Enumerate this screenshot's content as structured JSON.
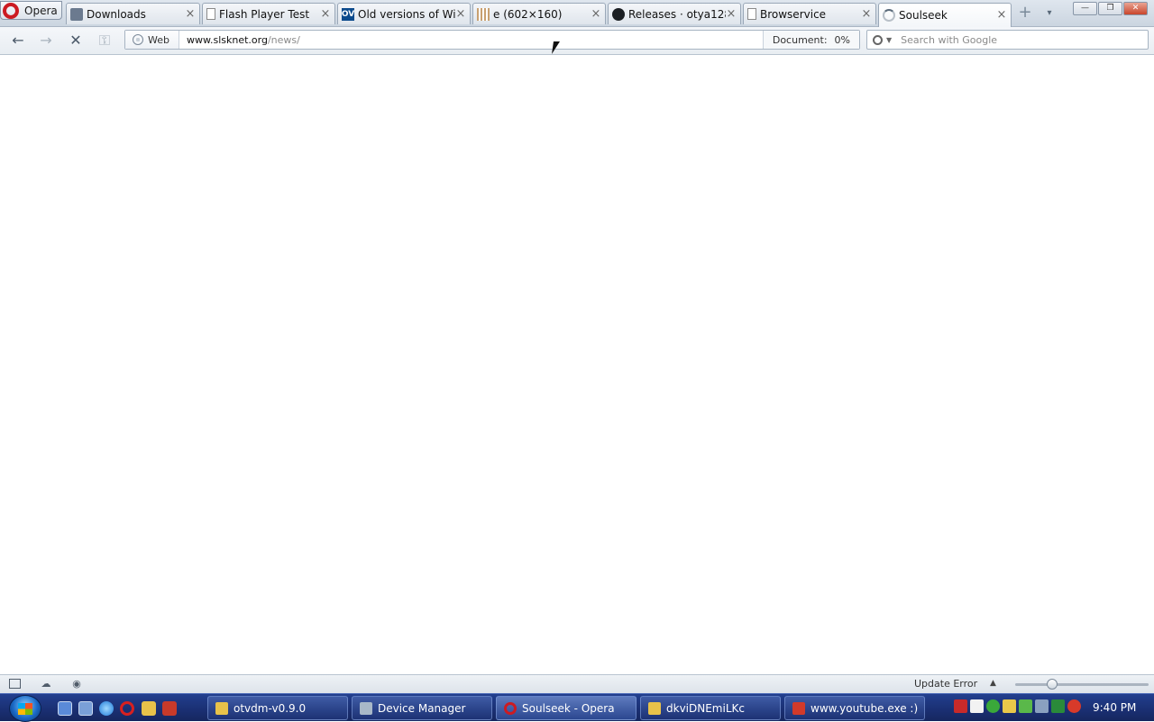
{
  "browser": {
    "menu_label": "Opera",
    "tabs": [
      {
        "label": "Downloads",
        "icon": "download-icon"
      },
      {
        "label": "Flash Player Test",
        "icon": "page-icon"
      },
      {
        "label": "Old versions of Wi...",
        "icon": "oldversion-icon",
        "icon_text": "OV"
      },
      {
        "label": "e (602×160)",
        "icon": "image-icon"
      },
      {
        "label": "Releases · otya128/...",
        "icon": "github-icon"
      },
      {
        "label": "Browservice",
        "icon": "page-icon"
      },
      {
        "label": "Soulseek",
        "icon": "loading-icon",
        "active": true
      }
    ],
    "tab_close_glyph": "×",
    "new_tab_glyph": "+",
    "tab_menu_glyph": "▾",
    "window_buttons": {
      "minimize": "—",
      "restore": "❐",
      "close": "✕"
    }
  },
  "toolbar": {
    "back_glyph": "←",
    "forward_glyph": "→",
    "stop_glyph": "✕",
    "key_glyph": "⚿",
    "web_badge": "Web",
    "url_host": "www.slsknet.org",
    "url_path": "/news/",
    "document_label": "Document:",
    "document_progress": "0%",
    "search_placeholder": "Search with Google"
  },
  "statusbar": {
    "update_error": "Update Error",
    "up_arrow": "▲",
    "zoom_level": 0.28
  },
  "taskbar": {
    "tasks": [
      {
        "label": "otvdm-v0.9.0",
        "icon_color": "#e8c24a"
      },
      {
        "label": "Device Manager",
        "icon_color": "#a8b8c8"
      },
      {
        "label": "Soulseek - Opera",
        "icon_color": "#cc1b22",
        "active": true
      },
      {
        "label": "dkviDNEmiLKc",
        "icon_color": "#e8c24a"
      },
      {
        "label": "www.youtube.exe :)",
        "icon_color": "#d23a2a"
      }
    ],
    "clock": "9:40 PM"
  }
}
